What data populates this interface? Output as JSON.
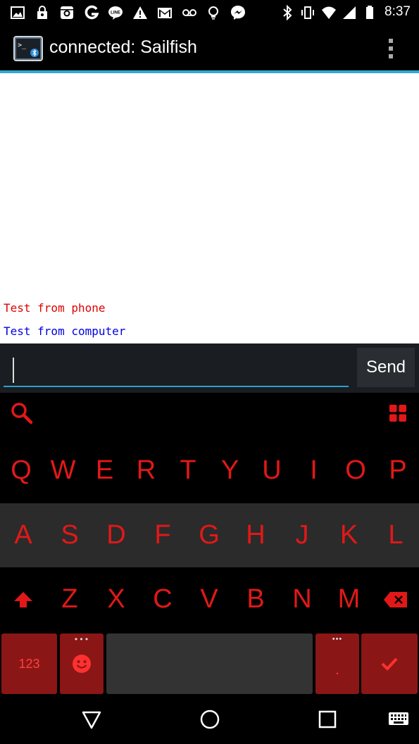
{
  "status_bar": {
    "time": "8:37",
    "left_icons": [
      "image-icon",
      "lock-icon",
      "instagram-icon",
      "google-icon",
      "line-icon",
      "warning-icon",
      "gmail-icon",
      "voicemail-icon",
      "bulb-icon",
      "messenger-icon"
    ],
    "right_icons": [
      "bluetooth-icon",
      "vibrate-icon",
      "wifi-icon",
      "cell-signal-icon",
      "battery-icon"
    ]
  },
  "app_bar": {
    "title": "connected: Sailfish",
    "accent_color": "#33a7d8"
  },
  "terminal": {
    "lines": [
      {
        "text": "Test from phone",
        "color": "#e00000"
      },
      {
        "text": "Test from computer",
        "color": "#0000e0"
      }
    ]
  },
  "input": {
    "value": "",
    "send_label": "Send"
  },
  "keyboard": {
    "row1": [
      "Q",
      "W",
      "E",
      "R",
      "T",
      "Y",
      "U",
      "I",
      "O",
      "P"
    ],
    "row2": [
      "A",
      "S",
      "D",
      "F",
      "G",
      "H",
      "J",
      "K",
      "L"
    ],
    "row3": [
      "Z",
      "X",
      "C",
      "V",
      "B",
      "N",
      "M"
    ],
    "numbers_label": "123",
    "period_label": ".",
    "key_color": "#e21818"
  },
  "nav_bar": {
    "icons": [
      "back-icon",
      "home-icon",
      "recents-icon",
      "keyboard-switch-icon"
    ]
  }
}
